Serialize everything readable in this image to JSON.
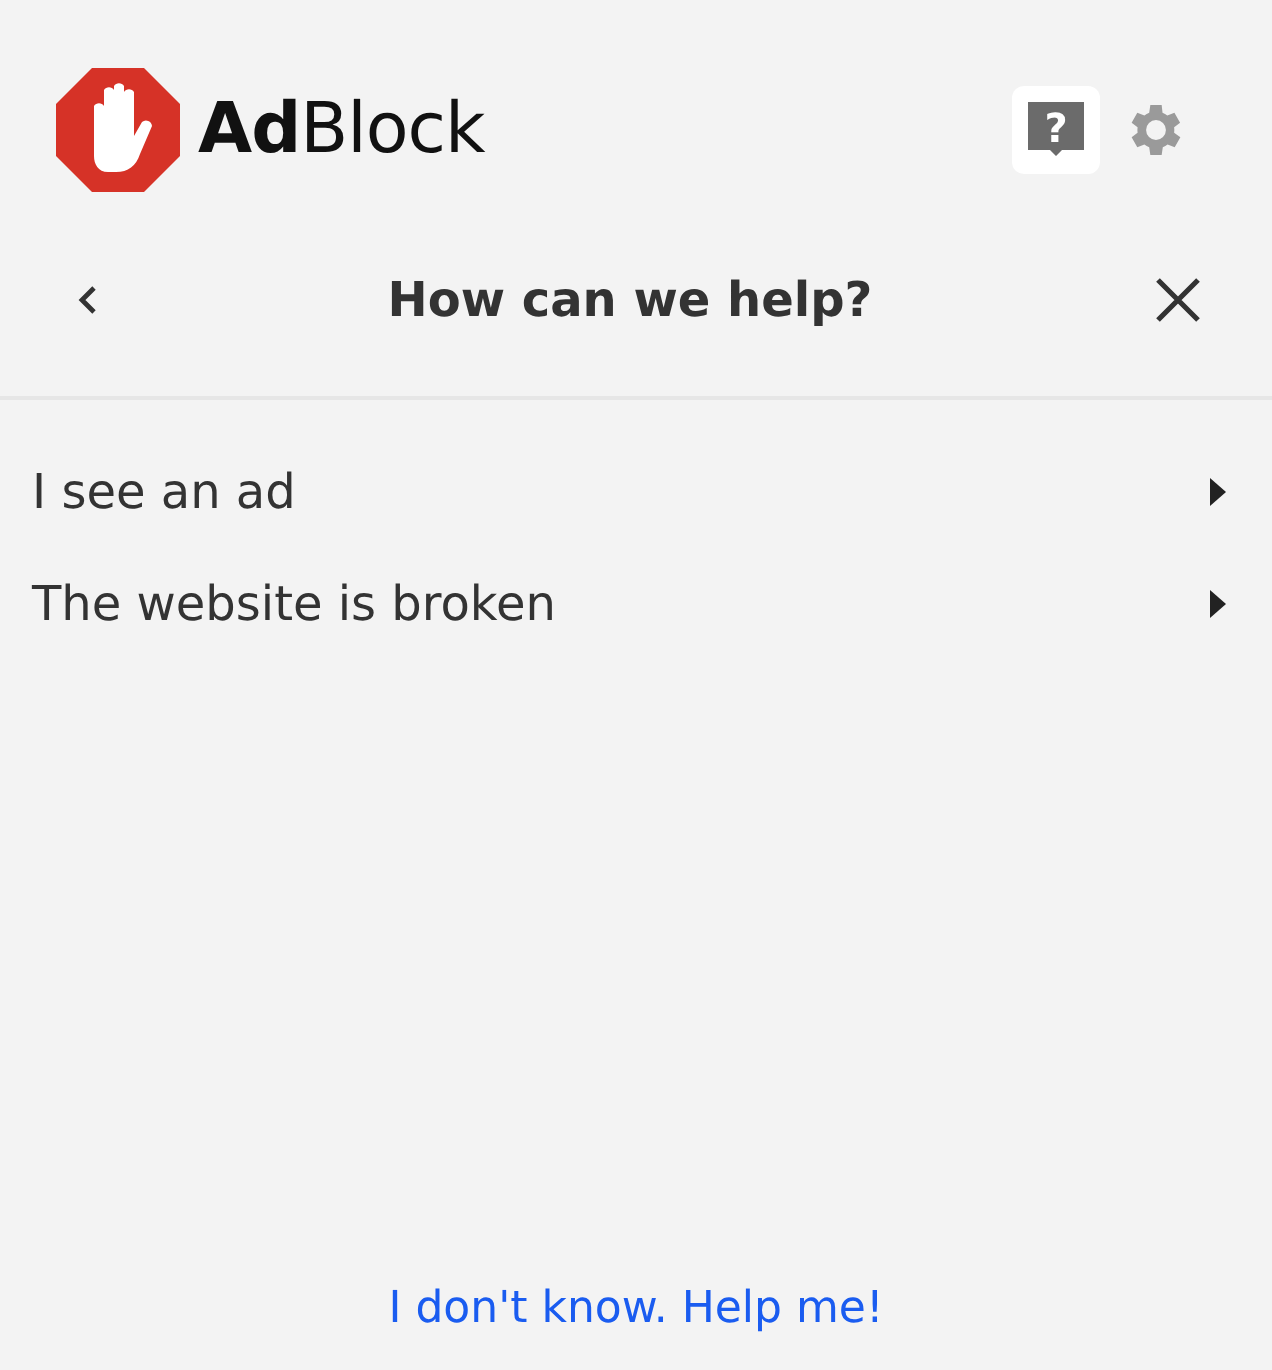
{
  "header": {
    "logo_text": "**Ad**Block",
    "toolbar": [
      {
        "kind": "help",
        "glyph": "?",
        "selected": true
      },
      {
        "kind": "settings",
        "selected": false
      }
    ]
  },
  "nav": {
    "title": "How can we help?"
  },
  "options": [
    {
      "label": "I see an ad"
    },
    {
      "label": "The website is broken"
    }
  ],
  "footer_link": "I don't know. Help me!"
}
